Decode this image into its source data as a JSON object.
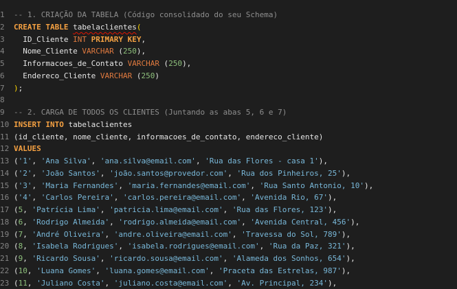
{
  "colors": {
    "background": "#1e1e1e",
    "line_number": "#858585",
    "comment": "#8e8e8e",
    "keyword": "#f5a142",
    "type": "#e07a3f",
    "string": "#79b8d9",
    "number": "#8ec07c",
    "plain": "#e6e6e6",
    "bracket": "#ffd700",
    "error_squiggle": "#e51400"
  },
  "editor": {
    "lines": [
      {
        "n": "1",
        "tokens": [
          {
            "t": "comment",
            "v": "-- 1. CRIAÇÃO DA TABELA (Código consolidado do seu Schema)"
          }
        ]
      },
      {
        "n": "2",
        "tokens": [
          {
            "t": "keyword",
            "v": "CREATE TABLE",
            "b": true
          },
          {
            "t": "plain",
            "v": " "
          },
          {
            "t": "squiggle",
            "v": "tabelaclientes"
          },
          {
            "t": "bracket",
            "v": "("
          }
        ]
      },
      {
        "n": "3",
        "tokens": [
          {
            "t": "plain",
            "v": "  ID_Cliente "
          },
          {
            "t": "type",
            "v": "INT"
          },
          {
            "t": "plain",
            "v": " "
          },
          {
            "t": "keyword",
            "v": "PRIMARY KEY",
            "b": true
          },
          {
            "t": "plain",
            "v": ","
          }
        ]
      },
      {
        "n": "4",
        "tokens": [
          {
            "t": "plain",
            "v": "  Nome_Cliente "
          },
          {
            "t": "type",
            "v": "VARCHAR"
          },
          {
            "t": "plain",
            "v": " ("
          },
          {
            "t": "number",
            "v": "250"
          },
          {
            "t": "plain",
            "v": "),"
          }
        ]
      },
      {
        "n": "5",
        "tokens": [
          {
            "t": "plain",
            "v": "  Informacoes_de_Contato "
          },
          {
            "t": "type",
            "v": "VARCHAR"
          },
          {
            "t": "plain",
            "v": " ("
          },
          {
            "t": "number",
            "v": "250"
          },
          {
            "t": "plain",
            "v": "),"
          }
        ]
      },
      {
        "n": "6",
        "tokens": [
          {
            "t": "plain",
            "v": "  Endereco_Cliente "
          },
          {
            "t": "type",
            "v": "VARCHAR"
          },
          {
            "t": "plain",
            "v": " ("
          },
          {
            "t": "number",
            "v": "250"
          },
          {
            "t": "plain",
            "v": ")"
          }
        ]
      },
      {
        "n": "7",
        "tokens": [
          {
            "t": "bracket",
            "v": ")"
          },
          {
            "t": "plain",
            "v": ";"
          }
        ]
      },
      {
        "n": "8",
        "tokens": []
      },
      {
        "n": "9",
        "tokens": [
          {
            "t": "comment",
            "v": "-- 2. CARGA DE TODOS OS CLIENTES (Juntando as abas 5, 6 e 7)"
          }
        ]
      },
      {
        "n": "10",
        "tokens": [
          {
            "t": "keyword",
            "v": "INSERT INTO",
            "b": true
          },
          {
            "t": "plain",
            "v": " tabelaclientes"
          }
        ]
      },
      {
        "n": "11",
        "tokens": [
          {
            "t": "plain",
            "v": "(id_cliente, nome_cliente, informacoes_de_contato, endereco_cliente)"
          }
        ]
      },
      {
        "n": "12",
        "tokens": [
          {
            "t": "keyword",
            "v": "VALUES",
            "b": true
          }
        ]
      },
      {
        "n": "13",
        "tokens": [
          {
            "t": "plain",
            "v": "("
          },
          {
            "t": "string",
            "v": "'1'"
          },
          {
            "t": "plain",
            "v": ", "
          },
          {
            "t": "string",
            "v": "'Ana Silva'"
          },
          {
            "t": "plain",
            "v": ", "
          },
          {
            "t": "string",
            "v": "'ana.silva@email.com'"
          },
          {
            "t": "plain",
            "v": ", "
          },
          {
            "t": "string",
            "v": "'Rua das Flores - casa 1'"
          },
          {
            "t": "plain",
            "v": "),"
          }
        ]
      },
      {
        "n": "14",
        "tokens": [
          {
            "t": "plain",
            "v": "("
          },
          {
            "t": "string",
            "v": "'2'"
          },
          {
            "t": "plain",
            "v": ", "
          },
          {
            "t": "string",
            "v": "'João Santos'"
          },
          {
            "t": "plain",
            "v": ", "
          },
          {
            "t": "string",
            "v": "'joão.santos@provedor.com'"
          },
          {
            "t": "plain",
            "v": ", "
          },
          {
            "t": "string",
            "v": "'Rua dos Pinheiros, 25'"
          },
          {
            "t": "plain",
            "v": "),"
          }
        ]
      },
      {
        "n": "15",
        "tokens": [
          {
            "t": "plain",
            "v": "("
          },
          {
            "t": "string",
            "v": "'3'"
          },
          {
            "t": "plain",
            "v": ", "
          },
          {
            "t": "string",
            "v": "'Maria Fernandes'"
          },
          {
            "t": "plain",
            "v": ", "
          },
          {
            "t": "string",
            "v": "'maria.fernandes@email.com'"
          },
          {
            "t": "plain",
            "v": ", "
          },
          {
            "t": "string",
            "v": "'Rua Santo Antonio, 10'"
          },
          {
            "t": "plain",
            "v": "),"
          }
        ]
      },
      {
        "n": "16",
        "tokens": [
          {
            "t": "plain",
            "v": "("
          },
          {
            "t": "string",
            "v": "'4'"
          },
          {
            "t": "plain",
            "v": ", "
          },
          {
            "t": "string",
            "v": "'Carlos Pereira'"
          },
          {
            "t": "plain",
            "v": ", "
          },
          {
            "t": "string",
            "v": "'carlos.pereira@email.com'"
          },
          {
            "t": "plain",
            "v": ", "
          },
          {
            "t": "string",
            "v": "'Avenida Rio, 67'"
          },
          {
            "t": "plain",
            "v": "),"
          }
        ]
      },
      {
        "n": "17",
        "tokens": [
          {
            "t": "plain",
            "v": "("
          },
          {
            "t": "number",
            "v": "5"
          },
          {
            "t": "plain",
            "v": ", "
          },
          {
            "t": "string",
            "v": "'Patrícia Lima'"
          },
          {
            "t": "plain",
            "v": ", "
          },
          {
            "t": "string",
            "v": "'patricia.lima@email.com'"
          },
          {
            "t": "plain",
            "v": ", "
          },
          {
            "t": "string",
            "v": "'Rua das Flores, 123'"
          },
          {
            "t": "plain",
            "v": "),"
          }
        ]
      },
      {
        "n": "18",
        "tokens": [
          {
            "t": "plain",
            "v": "("
          },
          {
            "t": "number",
            "v": "6"
          },
          {
            "t": "plain",
            "v": ", "
          },
          {
            "t": "string",
            "v": "'Rodrigo Almeida'"
          },
          {
            "t": "plain",
            "v": ", "
          },
          {
            "t": "string",
            "v": "'rodrigo.almeida@email.com'"
          },
          {
            "t": "plain",
            "v": ", "
          },
          {
            "t": "string",
            "v": "'Avenida Central, 456'"
          },
          {
            "t": "plain",
            "v": "),"
          }
        ]
      },
      {
        "n": "19",
        "tokens": [
          {
            "t": "plain",
            "v": "("
          },
          {
            "t": "number",
            "v": "7"
          },
          {
            "t": "plain",
            "v": ", "
          },
          {
            "t": "string",
            "v": "'André Oliveira'"
          },
          {
            "t": "plain",
            "v": ", "
          },
          {
            "t": "string",
            "v": "'andre.oliveira@email.com'"
          },
          {
            "t": "plain",
            "v": ", "
          },
          {
            "t": "string",
            "v": "'Travessa do Sol, 789'"
          },
          {
            "t": "plain",
            "v": "),"
          }
        ]
      },
      {
        "n": "20",
        "tokens": [
          {
            "t": "plain",
            "v": "("
          },
          {
            "t": "number",
            "v": "8"
          },
          {
            "t": "plain",
            "v": ", "
          },
          {
            "t": "string",
            "v": "'Isabela Rodrigues'"
          },
          {
            "t": "plain",
            "v": ", "
          },
          {
            "t": "string",
            "v": "'isabela.rodrigues@email.com'"
          },
          {
            "t": "plain",
            "v": ", "
          },
          {
            "t": "string",
            "v": "'Rua da Paz, 321'"
          },
          {
            "t": "plain",
            "v": "),"
          }
        ]
      },
      {
        "n": "21",
        "tokens": [
          {
            "t": "plain",
            "v": "("
          },
          {
            "t": "number",
            "v": "9"
          },
          {
            "t": "plain",
            "v": ", "
          },
          {
            "t": "string",
            "v": "'Ricardo Sousa'"
          },
          {
            "t": "plain",
            "v": ", "
          },
          {
            "t": "string",
            "v": "'ricardo.sousa@email.com'"
          },
          {
            "t": "plain",
            "v": ", "
          },
          {
            "t": "string",
            "v": "'Alameda dos Sonhos, 654'"
          },
          {
            "t": "plain",
            "v": "),"
          }
        ]
      },
      {
        "n": "22",
        "tokens": [
          {
            "t": "plain",
            "v": "("
          },
          {
            "t": "number",
            "v": "10"
          },
          {
            "t": "plain",
            "v": ", "
          },
          {
            "t": "string",
            "v": "'Luana Gomes'"
          },
          {
            "t": "plain",
            "v": ", "
          },
          {
            "t": "string",
            "v": "'luana.gomes@email.com'"
          },
          {
            "t": "plain",
            "v": ", "
          },
          {
            "t": "string",
            "v": "'Praceta das Estrelas, 987'"
          },
          {
            "t": "plain",
            "v": "),"
          }
        ]
      },
      {
        "n": "23",
        "tokens": [
          {
            "t": "plain",
            "v": "("
          },
          {
            "t": "number",
            "v": "11"
          },
          {
            "t": "plain",
            "v": ", "
          },
          {
            "t": "string",
            "v": "'Juliano Costa'"
          },
          {
            "t": "plain",
            "v": ", "
          },
          {
            "t": "string",
            "v": "'juliano.costa@email.com'"
          },
          {
            "t": "plain",
            "v": ", "
          },
          {
            "t": "string",
            "v": "'Av. Principal, 234'"
          },
          {
            "t": "plain",
            "v": "),"
          }
        ]
      }
    ]
  }
}
